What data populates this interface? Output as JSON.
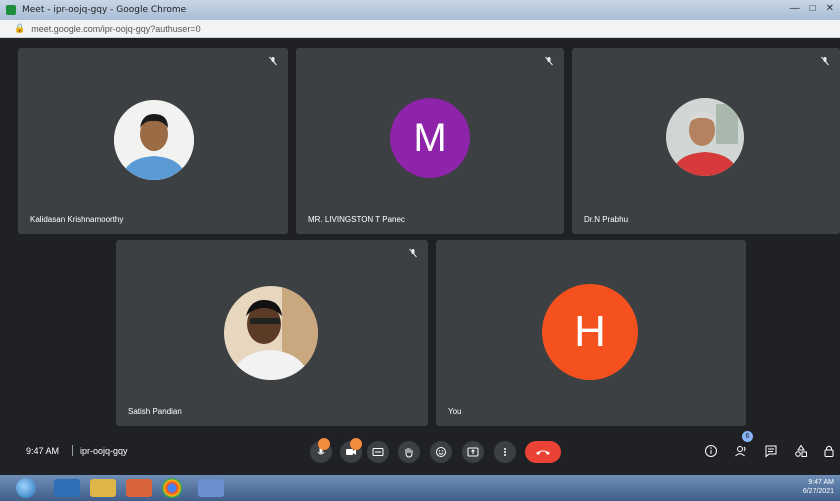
{
  "window": {
    "title": "Meet - ipr-oojq-gqy - Google Chrome",
    "url": "meet.google.com/ipr-oojq-gqy?authuser=0"
  },
  "participants": [
    {
      "name": "Kalidasan Krishnamoorthy",
      "avatar": "photo"
    },
    {
      "name": "MR. LIVINGSTON T Panec",
      "avatar": "letter",
      "letter": "M",
      "color": "#8e24aa"
    },
    {
      "name": "Dr.N Prabhu",
      "avatar": "photo"
    },
    {
      "name": "Satish Pandian",
      "avatar": "photo"
    },
    {
      "name": "You",
      "avatar": "letter",
      "letter": "H",
      "color": "#f4511e"
    }
  ],
  "meeting": {
    "time": "9:47 AM",
    "code": "ipr-oojq-gqy"
  },
  "people_count": "6",
  "taskbar": {
    "time": "9:47 AM",
    "date": "6/27/2021"
  },
  "colors": {
    "tile_bg": "#3c4043",
    "stage_bg": "#202124",
    "hangup": "#ea4335",
    "mic_on": "#f28b3c"
  },
  "icons": [
    "microphone-icon",
    "camera-icon",
    "captions-icon",
    "raise-hand-icon",
    "emoji-icon",
    "present-icon",
    "more-options-icon",
    "hang-up-icon",
    "info-icon",
    "people-icon",
    "chat-icon",
    "activities-icon",
    "host-controls-icon"
  ]
}
